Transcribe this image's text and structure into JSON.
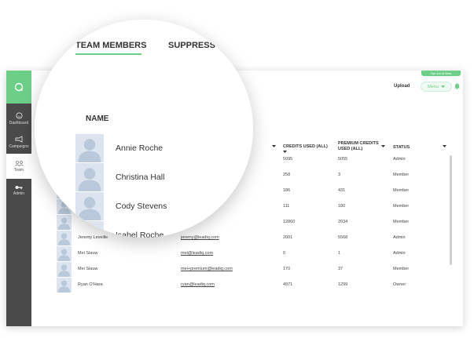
{
  "topbar": {
    "pill_text": "Opt out of Beta",
    "upload_label": "Upload",
    "menu_label": "Menu"
  },
  "sidebar": {
    "items": [
      {
        "label": "Dashboard",
        "icon": "dashboard-icon"
      },
      {
        "label": "Campaigns",
        "icon": "megaphone-icon"
      },
      {
        "label": "Team",
        "icon": "team-icon"
      },
      {
        "label": "Admin",
        "icon": "key-icon"
      }
    ]
  },
  "table": {
    "headers": {
      "credits": "CREDITS USED (ALL)",
      "premium": "PREMIUM CREDITS USED (ALL)",
      "status": "STATUS"
    },
    "rows": [
      {
        "name": "",
        "email": "",
        "credits": "5095",
        "premium": "5055",
        "status": "Admin"
      },
      {
        "name": "",
        "email": "",
        "credits": "258",
        "premium": "3",
        "status": "Member"
      },
      {
        "name": "",
        "email": "",
        "credits": "186",
        "premium": "431",
        "status": "Member"
      },
      {
        "name": "",
        "email": "",
        "credits": "111",
        "premium": "180",
        "status": "Member"
      },
      {
        "name": "",
        "email": "",
        "credits": "12860",
        "premium": "2034",
        "status": "Member"
      },
      {
        "name": "Jeremy Leveille",
        "email": "jeremy@leadiq.com",
        "credits": "2001",
        "premium": "5568",
        "status": "Admin"
      },
      {
        "name": "Mei Siauw",
        "email": "mei@leadiq.com",
        "credits": "0",
        "premium": "1",
        "status": "Admin"
      },
      {
        "name": "Mei Siauw",
        "email": "mei+premium@leadiq.com",
        "credits": "170",
        "premium": "37",
        "status": "Member"
      },
      {
        "name": "Ryan O'Hara",
        "email": "ryan@leadiq.com",
        "credits": "4971",
        "premium": "1299",
        "status": "Owner"
      }
    ]
  },
  "magnifier": {
    "tabs": [
      "TEAM MEMBERS",
      "SUPPRESS"
    ],
    "name_header": "NAME",
    "names": [
      "Annie Roche",
      "Christina Hall",
      "Cody Stevens",
      "Isabel Roche"
    ]
  },
  "colors": {
    "accent": "#6ccf88",
    "sidebar": "#4a4a4a",
    "avatar_bg": "#dbe4ef"
  }
}
